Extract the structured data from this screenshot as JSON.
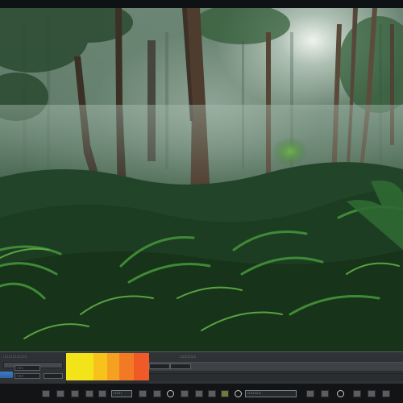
{
  "viewport": {
    "scene": "forest-render-preview"
  },
  "panel": {
    "left_title": "::::::::::::::::::",
    "left_field_a": "::::::",
    "left_field_b": "::::::",
    "right_title": ":::::::::::::::",
    "swatch_colors": [
      "#f3e41a",
      "#f7c21c",
      "#f5a021",
      "#f27a24",
      "#ef5a26"
    ]
  },
  "toolbar": {
    "field_1": "::::::",
    "field_2": "::::::::::"
  },
  "colors": {
    "panel_bg": "#2b2e31",
    "toolbar_bg": "#121416",
    "accent_blue": "#3b7bc8"
  }
}
